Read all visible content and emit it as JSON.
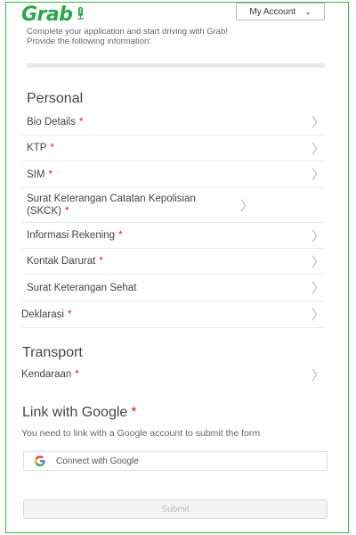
{
  "header": {
    "logo_text": "Grab",
    "account_label": "My Account",
    "account_chevron": "⌄"
  },
  "intro": {
    "line1": "Complete your application and start driving with Grab!",
    "line2": "Provide the following information:"
  },
  "progress": {
    "percent": 0
  },
  "personal": {
    "title": "Personal",
    "items": [
      {
        "label": "Bio Details",
        "required": "*"
      },
      {
        "label": "KTP",
        "required": "*"
      },
      {
        "label": "SIM",
        "required": "*"
      },
      {
        "label": "Surat Keterangan Catatan Kepolisian (SKCK)",
        "required": "*"
      },
      {
        "label": "Informasi Rekening",
        "required": "*"
      },
      {
        "label": "Kontak Darurat",
        "required": "*"
      },
      {
        "label": "Surat Keterangan Sehat",
        "required": ""
      },
      {
        "label": "Deklarasi",
        "required": "*"
      }
    ]
  },
  "transport": {
    "title": "Transport",
    "items": [
      {
        "label": "Kendaraan",
        "required": "*"
      }
    ]
  },
  "google": {
    "title": "Link with Google",
    "required": "*",
    "description": "You need to link with a Google account to submit the form",
    "connect_label": "Connect with Google"
  },
  "submit": {
    "label": "Submit"
  },
  "colors": {
    "brand": "#2aa84a",
    "required": "#e02020",
    "google_blue": "#4285F4",
    "google_red": "#EA4335",
    "google_yellow": "#FBBC05",
    "google_green": "#34A853"
  },
  "icons": {
    "row_arrow": "〉"
  }
}
